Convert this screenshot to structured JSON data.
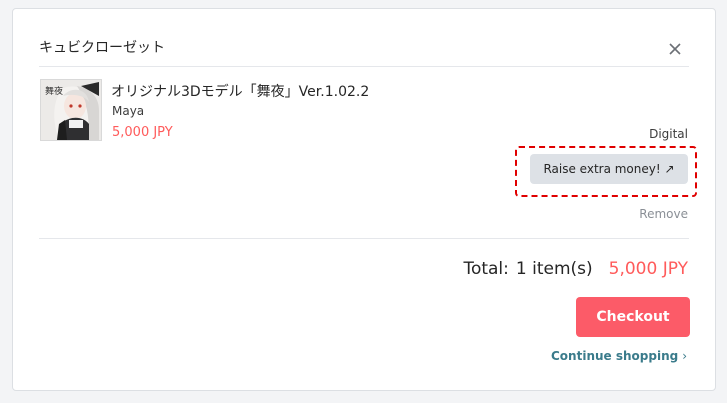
{
  "cart": {
    "shop_name": "キュビクローゼット",
    "item": {
      "title": "オリジナル3Dモデル「舞夜」Ver.1.02.2",
      "author": "Maya",
      "price": "5,000 JPY",
      "type": "Digital",
      "thumbnail_caption": "舞夜"
    },
    "boost_label": "Raise extra money! ↗",
    "remove_label": "Remove",
    "total": {
      "label": "Total:",
      "count": "1 item(s)",
      "price": "5,000 JPY"
    },
    "checkout_label": "Checkout",
    "continue_label": "Continue shopping",
    "continue_icon": "›"
  },
  "colors": {
    "price": "#ff5b5b",
    "checkout": "#fc5b68",
    "link": "#3a7b8b",
    "highlight": "#e00000"
  }
}
